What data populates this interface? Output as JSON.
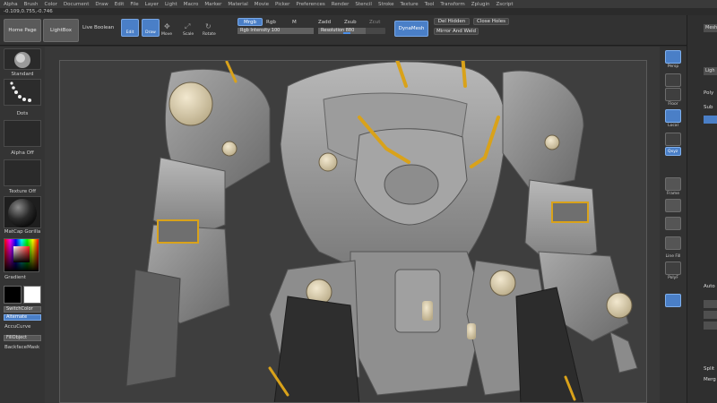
{
  "menu": [
    "Alpha",
    "Brush",
    "Color",
    "Document",
    "Draw",
    "Edit",
    "File",
    "Layer",
    "Light",
    "Macro",
    "Marker",
    "Material",
    "Movie",
    "Picker",
    "Preferences",
    "Render",
    "Stencil",
    "Stroke",
    "Texture",
    "Tool",
    "Transform",
    "Zplugin",
    "Zscript"
  ],
  "coords": "-0.109,0.755,-0.746",
  "toolbar": {
    "home_page": "Home Page",
    "lightbox": "LightBox",
    "live_boolean": "Live Boolean",
    "edit": "Edit",
    "draw": "Draw",
    "move": "Move",
    "scale": "Scale",
    "rotate": "Rotate",
    "mrgb": "Mrgb",
    "rgb": "Rgb",
    "m": "M",
    "rgb_intensity": "Rgb Intensity 100",
    "zadd": "Zadd",
    "zsub": "Zsub",
    "zcut": "Zcut",
    "resolution": "Resolution 880",
    "dynamesh": "DynaMesh",
    "del_hidden": "Del Hidden",
    "close_holes": "Close Holes",
    "mirror_and_weld": "Mirror And Weld"
  },
  "left_panel": {
    "standard": "Standard",
    "dots": "Dots",
    "alpha_off": "Alpha Off",
    "texture_off": "Texture Off",
    "matcap": "MatCap Gorilla",
    "gradient": "Gradient",
    "switch_color": "SwitchColor",
    "alternate": "Alternate",
    "accucurve": "AccuCurve",
    "fill_object": "FillObject",
    "backface_mask": "BackfaceMask"
  },
  "right_shelf": {
    "persp": "Persp",
    "floor": "Floor",
    "local": "Local",
    "xyz": "Qxyz",
    "frame": "Frame",
    "line_fill": "Line Fill",
    "polyf": "PolyF",
    "transp": "Transp"
  },
  "right_panel": {
    "mesh": "Mesh",
    "ligh": "Ligh",
    "poly": "Poly",
    "sub": "Sub",
    "auto": "Auto",
    "split": "Split",
    "merg": "Merg"
  },
  "colors": {
    "accent_blue": "#4a7fc7",
    "gold_trim": "#d9a21a",
    "panel": "#323232"
  }
}
